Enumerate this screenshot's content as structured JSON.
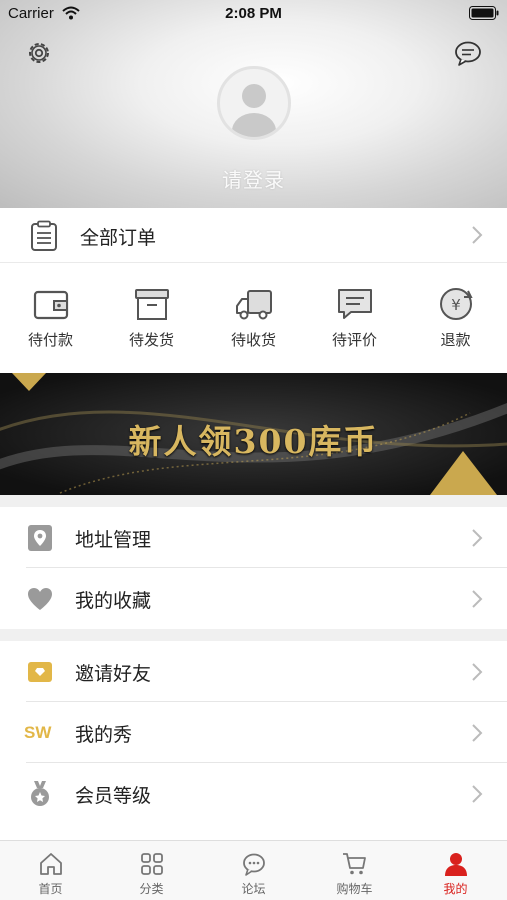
{
  "status_bar": {
    "carrier": "Carrier",
    "time": "2:08 PM"
  },
  "header": {
    "login_text": "请登录"
  },
  "orders": {
    "all_orders_label": "全部订单",
    "statuses": [
      {
        "label": "待付款",
        "icon": "wallet-icon"
      },
      {
        "label": "待发货",
        "icon": "box-icon"
      },
      {
        "label": "待收货",
        "icon": "truck-icon"
      },
      {
        "label": "待评价",
        "icon": "comment-icon"
      },
      {
        "label": "退款",
        "icon": "refund-icon"
      }
    ]
  },
  "banner": {
    "text": "新人领300库币"
  },
  "menu_group_1": [
    {
      "label": "地址管理",
      "icon": "location-icon"
    },
    {
      "label": "我的收藏",
      "icon": "heart-icon"
    }
  ],
  "menu_group_2": [
    {
      "label": "邀请好友",
      "icon": "invite-icon"
    },
    {
      "label": "我的秀",
      "icon": "sw-icon",
      "icon_text": "SW"
    },
    {
      "label": "会员等级",
      "icon": "medal-icon"
    }
  ],
  "tabbar": [
    {
      "label": "首页",
      "icon": "home-icon"
    },
    {
      "label": "分类",
      "icon": "grid-icon"
    },
    {
      "label": "论坛",
      "icon": "forum-icon"
    },
    {
      "label": "购物车",
      "icon": "cart-icon"
    },
    {
      "label": "我的",
      "icon": "user-icon",
      "active": true
    }
  ],
  "colors": {
    "accent_gold": "#e2b748",
    "active_red": "#d9211d",
    "icon_gray": "#7a7a7a"
  }
}
